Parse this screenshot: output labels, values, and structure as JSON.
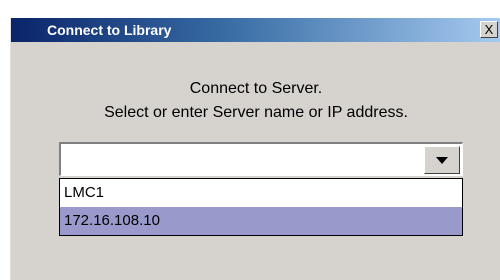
{
  "window": {
    "title": "Connect to Library",
    "close_label": "X"
  },
  "message": {
    "line1": "Connect to Server.",
    "line2": "Select or enter Server name or IP address."
  },
  "server_combo": {
    "value": "",
    "placeholder": ""
  },
  "dropdown": {
    "options": [
      "LMC1",
      "172.16.108.10"
    ],
    "highlighted": "172.16.108.10"
  },
  "colors": {
    "title_gradient_start": "#0a246a",
    "title_gradient_end": "#a6caf0",
    "dialog_bg": "#d6d3ce",
    "highlight": "#9999cc"
  }
}
